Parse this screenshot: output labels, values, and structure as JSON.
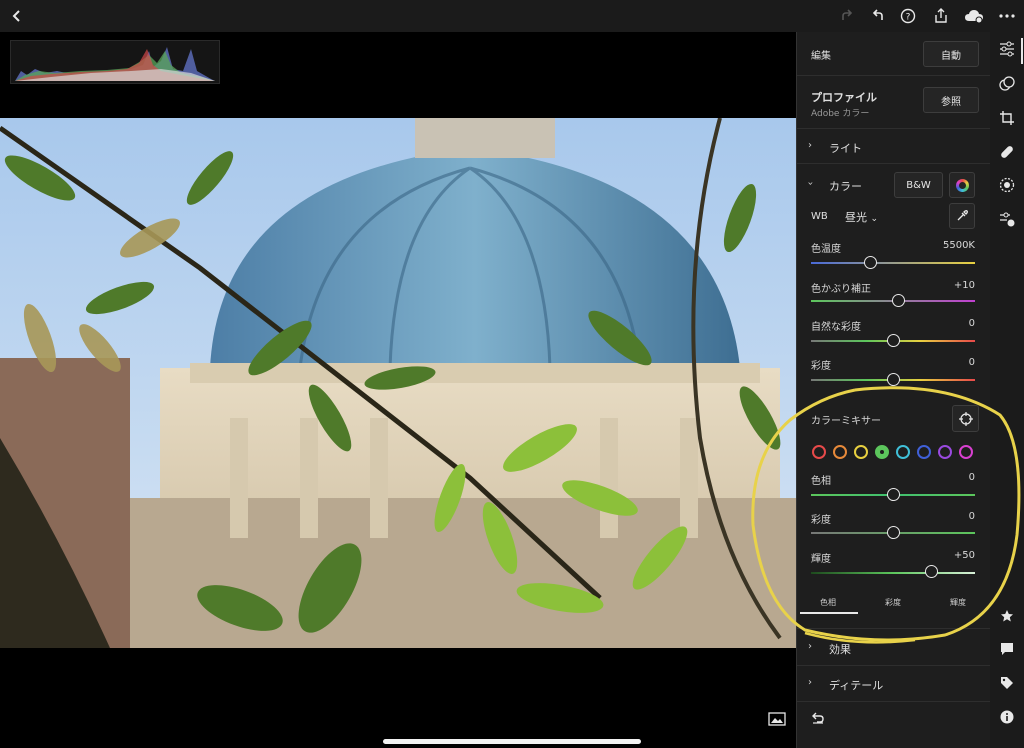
{
  "panel": {
    "edit_title": "編集",
    "auto_label": "自動",
    "profile_title": "プロファイル",
    "profile_value": "Adobe カラー",
    "browse_label": "参照",
    "light_label": "ライト",
    "color_label": "カラー",
    "bw_label": "B&W",
    "wb_label": "WB",
    "wb_value": "昼光",
    "sliders": [
      {
        "label": "色温度",
        "value": "5500K"
      },
      {
        "label": "色かぶり補正",
        "value": "+10"
      },
      {
        "label": "自然な彩度",
        "value": "0"
      },
      {
        "label": "彩度",
        "value": "0"
      }
    ],
    "mixer_title": "カラーミキサー",
    "mixer_swatches": [
      "#e84a4a",
      "#e88a3a",
      "#e8d040",
      "#5cc65c",
      "#40c0d8",
      "#4060d8",
      "#9a4ae0",
      "#d840d0"
    ],
    "mixer_sliders": [
      {
        "label": "色相",
        "value": "0"
      },
      {
        "label": "彩度",
        "value": "0"
      },
      {
        "label": "輝度",
        "value": "+50"
      }
    ],
    "mixer_tabs": [
      "色相",
      "彩度",
      "輝度"
    ],
    "effects_label": "効果",
    "detail_label": "ディテール"
  }
}
